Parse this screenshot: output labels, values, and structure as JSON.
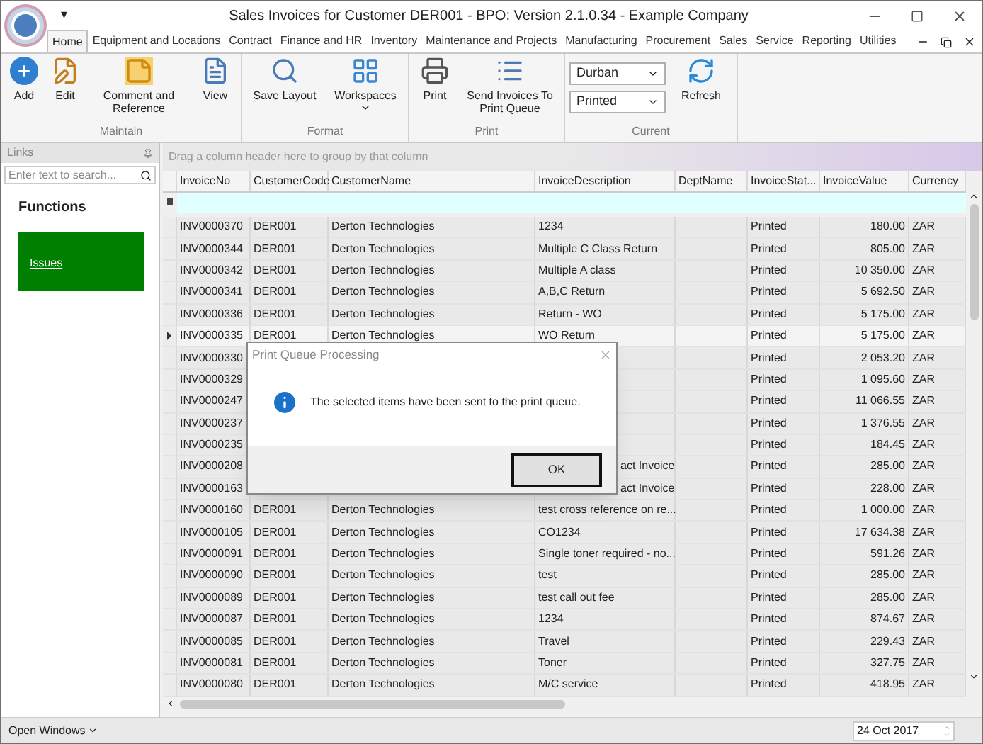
{
  "window": {
    "title": "Sales Invoices for Customer DER001 - BPO: Version 2.1.0.34 - Example Company",
    "quick_access": "▾"
  },
  "tabs": [
    {
      "label": "Home",
      "selected": true
    },
    {
      "label": "Equipment and Locations",
      "selected": false
    },
    {
      "label": "Contract",
      "selected": false
    },
    {
      "label": "Finance and HR",
      "selected": false
    },
    {
      "label": "Inventory",
      "selected": false
    },
    {
      "label": "Maintenance and Projects",
      "selected": false
    },
    {
      "label": "Manufacturing",
      "selected": false
    },
    {
      "label": "Procurement",
      "selected": false
    },
    {
      "label": "Sales",
      "selected": false
    },
    {
      "label": "Service",
      "selected": false
    },
    {
      "label": "Reporting",
      "selected": false
    },
    {
      "label": "Utilities",
      "selected": false
    }
  ],
  "ribbon": [
    {
      "label": "Maintain",
      "items": [
        {
          "kind": "button",
          "label": "Add"
        },
        {
          "kind": "button",
          "label": "Edit"
        },
        {
          "kind": "button",
          "label": "Comment and Reference"
        },
        {
          "kind": "button",
          "label": "View"
        }
      ]
    },
    {
      "label": "Format",
      "items": [
        {
          "kind": "button",
          "label": "Save Layout"
        },
        {
          "kind": "button",
          "label": "Workspaces",
          "dropdown": true
        }
      ]
    },
    {
      "label": "Print",
      "items": [
        {
          "kind": "button",
          "label": "Print"
        },
        {
          "kind": "button",
          "label": "Send Invoices To Print Queue"
        }
      ]
    },
    {
      "label": "Current",
      "items": [
        {
          "kind": "selects",
          "values": [
            "Durban",
            "Printed"
          ]
        },
        {
          "kind": "button",
          "label": "Refresh"
        }
      ]
    }
  ],
  "links": {
    "title": "Links",
    "search": {
      "placeholder": "Enter text to search..."
    },
    "heading": "Functions",
    "tiles": [
      {
        "label": "Issues",
        "color": "#008000"
      }
    ]
  },
  "grid": {
    "group_hint": "Drag a column header here to group by that column",
    "columns": [
      "InvoiceNo",
      "CustomerCode",
      "CustomerName",
      "InvoiceDescription",
      "DeptName",
      "InvoiceStat...",
      "InvoiceValue",
      "Currency"
    ],
    "rows": [
      {
        "selected": false,
        "invoice_no": "INV0000370",
        "customer_code": "DER001",
        "customer_name": "Derton Technologies",
        "description": "1234",
        "status": "Printed",
        "value": "180.00",
        "currency": "ZAR"
      },
      {
        "selected": false,
        "invoice_no": "INV0000344",
        "customer_code": "DER001",
        "customer_name": "Derton Technologies",
        "description": "Multiple C Class Return",
        "status": "Printed",
        "value": "805.00",
        "currency": "ZAR"
      },
      {
        "selected": false,
        "invoice_no": "INV0000342",
        "customer_code": "DER001",
        "customer_name": "Derton Technologies",
        "description": "Multiple A class",
        "status": "Printed",
        "value": "10 350.00",
        "currency": "ZAR"
      },
      {
        "selected": false,
        "invoice_no": "INV0000341",
        "customer_code": "DER001",
        "customer_name": "Derton Technologies",
        "description": "A,B,C Return",
        "status": "Printed",
        "value": "5 692.50",
        "currency": "ZAR"
      },
      {
        "selected": false,
        "invoice_no": "INV0000336",
        "customer_code": "DER001",
        "customer_name": "Derton Technologies",
        "description": "Return - WO",
        "status": "Printed",
        "value": "5 175.00",
        "currency": "ZAR"
      },
      {
        "selected": true,
        "invoice_no": "INV0000335",
        "customer_code": "DER001",
        "customer_name": "Derton Technologies",
        "description": "WO Return",
        "status": "Printed",
        "value": "5 175.00",
        "currency": "ZAR"
      },
      {
        "selected": false,
        "invoice_no": "INV0000330",
        "status": "Printed",
        "value": "2 053.20",
        "currency": "ZAR"
      },
      {
        "selected": false,
        "invoice_no": "INV0000329",
        "status": "Printed",
        "value": "1 095.60",
        "currency": "ZAR"
      },
      {
        "selected": false,
        "invoice_no": "INV0000247",
        "status": "Printed",
        "value": "11 066.55",
        "currency": "ZAR"
      },
      {
        "selected": false,
        "invoice_no": "INV0000237",
        "status": "Printed",
        "value": "1 376.55",
        "currency": "ZAR"
      },
      {
        "selected": false,
        "invoice_no": "INV0000235",
        "status": "Printed",
        "value": "184.45",
        "currency": "ZAR"
      },
      {
        "selected": false,
        "invoice_no": "INV0000208",
        "description": "act Invoice",
        "status": "Printed",
        "value": "285.00",
        "currency": "ZAR"
      },
      {
        "selected": false,
        "invoice_no": "INV0000163",
        "description": "act Invoice",
        "status": "Printed",
        "value": "228.00",
        "currency": "ZAR"
      },
      {
        "selected": false,
        "invoice_no": "INV0000160",
        "customer_code": "DER001",
        "customer_name": "Derton Technologies",
        "description": "test cross reference on re...",
        "status": "Printed",
        "value": "1 000.00",
        "currency": "ZAR"
      },
      {
        "selected": false,
        "invoice_no": "INV0000105",
        "customer_code": "DER001",
        "customer_name": "Derton Technologies",
        "description": "CO1234",
        "status": "Printed",
        "value": "17 634.38",
        "currency": "ZAR"
      },
      {
        "selected": false,
        "invoice_no": "INV0000091",
        "customer_code": "DER001",
        "customer_name": "Derton Technologies",
        "description": "Single toner required - no...",
        "status": "Printed",
        "value": "591.26",
        "currency": "ZAR"
      },
      {
        "selected": false,
        "invoice_no": "INV0000090",
        "customer_code": "DER001",
        "customer_name": "Derton Technologies",
        "description": "test",
        "status": "Printed",
        "value": "285.00",
        "currency": "ZAR"
      },
      {
        "selected": false,
        "invoice_no": "INV0000089",
        "customer_code": "DER001",
        "customer_name": "Derton Technologies",
        "description": "test call out fee",
        "status": "Printed",
        "value": "285.00",
        "currency": "ZAR"
      },
      {
        "selected": false,
        "invoice_no": "INV0000087",
        "customer_code": "DER001",
        "customer_name": "Derton Technologies",
        "description": "1234",
        "status": "Printed",
        "value": "874.67",
        "currency": "ZAR"
      },
      {
        "selected": false,
        "invoice_no": "INV0000085",
        "customer_code": "DER001",
        "customer_name": "Derton Technologies",
        "description": "Travel",
        "status": "Printed",
        "value": "229.43",
        "currency": "ZAR"
      },
      {
        "selected": false,
        "invoice_no": "INV0000081",
        "customer_code": "DER001",
        "customer_name": "Derton Technologies",
        "description": "Toner",
        "status": "Printed",
        "value": "327.75",
        "currency": "ZAR"
      },
      {
        "selected": false,
        "invoice_no": "INV0000080",
        "customer_code": "DER001",
        "customer_name": "Derton Technologies",
        "description": "M/C service",
        "status": "Printed",
        "value": "418.95",
        "currency": "ZAR"
      }
    ]
  },
  "dialog": {
    "title": "Print Queue Processing",
    "message": "The selected items have been sent to the print queue.",
    "button": "OK"
  },
  "status_bar": {
    "open_windows": "Open Windows",
    "date": "24 Oct 2017"
  }
}
